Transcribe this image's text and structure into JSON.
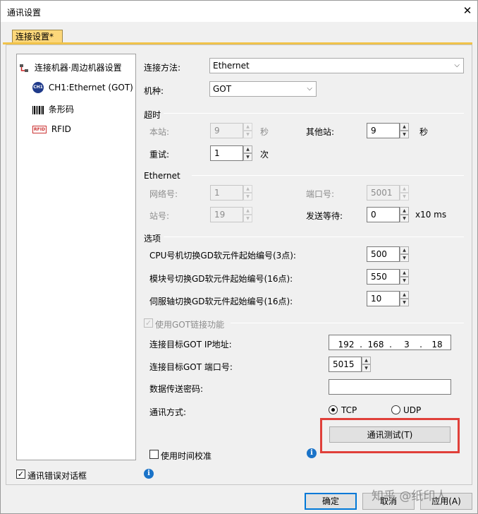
{
  "window": {
    "title": "通讯设置",
    "close_glyph": "✕"
  },
  "tab": {
    "label": "连接设置*"
  },
  "tree": {
    "root": "连接机器·周边机器设置",
    "items": [
      {
        "label": "CH1:Ethernet (GOT)",
        "icon": "ch1-icon",
        "icon_text": "CH1"
      },
      {
        "label": "条形码",
        "icon": "barcode-icon"
      },
      {
        "label": "RFID",
        "icon": "rfid-icon",
        "icon_text": "RFID"
      }
    ]
  },
  "connection": {
    "method_label": "连接方法:",
    "method_value": "Ethernet",
    "model_label": "机种:",
    "model_value": "GOT"
  },
  "timeout": {
    "title": "超时",
    "local_label": "本站:",
    "local_value": "9",
    "local_unit": "秒",
    "other_label": "其他站:",
    "other_value": "9",
    "other_unit": "秒",
    "retry_label": "重试:",
    "retry_value": "1",
    "retry_unit": "次"
  },
  "ethernet": {
    "title": "Ethernet",
    "network_label": "网络号:",
    "network_value": "1",
    "port_label": "端口号:",
    "port_value": "5001",
    "station_label": "站号:",
    "station_value": "19",
    "send_wait_label": "发送等待:",
    "send_wait_value": "0",
    "send_wait_unit": "x10 ms"
  },
  "options": {
    "title": "选项",
    "cpu_label": "CPU号机切换GD软元件起始编号(3点):",
    "cpu_value": "500",
    "module_label": "模块号切换GD软元件起始编号(16点):",
    "module_value": "550",
    "servo_label": "伺服轴切换GD软元件起始编号(16点):",
    "servo_value": "10"
  },
  "got_link": {
    "checkbox_label": "使用GOT链接功能",
    "checked": true,
    "ip_label": "连接目标GOT IP地址:",
    "ip": [
      "192",
      "168",
      "3",
      "18"
    ],
    "port_label": "连接目标GOT 端口号:",
    "port_value": "5015",
    "password_label": "数据传送密码:",
    "password_value": "",
    "comm_label": "通讯方式:",
    "tcp_label": "TCP",
    "udp_label": "UDP",
    "selected": "TCP",
    "test_button": "通讯测试(T)",
    "time_sync_label": "使用时间校准"
  },
  "footer": {
    "error_dialog_label": "通讯错误对话框",
    "ok_button": "确定",
    "cancel_button": "取消",
    "apply_button": "应用(A)",
    "watermark": "知乎 @纸印人"
  },
  "colors": {
    "tab": "#fcd77a",
    "tab_line": "#f0c24a",
    "highlight": "#e0403a",
    "info": "#1a73c8"
  }
}
